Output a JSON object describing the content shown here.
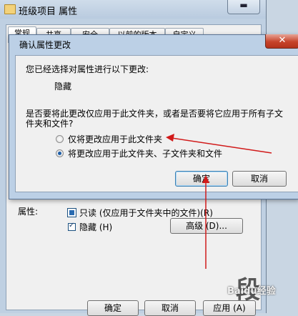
{
  "background_window": {
    "title": "班级项目 属性",
    "minimize_label": "▬",
    "tabs": [
      "常规",
      "共享",
      "安全",
      "以前的版本",
      "自定义"
    ],
    "attributes_label": "属性:",
    "readonly_label": "只读 (仅应用于文件夹中的文件)(R)",
    "hidden_label": "隐藏 (H)",
    "advanced_button": "高级 (D)...",
    "ok_button": "确定",
    "cancel_button": "取消",
    "apply_button": "应用 (A)"
  },
  "dialog": {
    "title": "确认属性更改",
    "close_label": "✕",
    "intro_text": "您已经选择对属性进行以下更改:",
    "change_item": "隐藏",
    "question_line1": "是否要将此更改仅应用于此文件夹，或者是否要将它应用于所有子文",
    "question_line2": "件夹和文件?",
    "options": [
      {
        "label": "仅将更改应用于此文件夹",
        "selected": false
      },
      {
        "label": "将更改应用于此文件夹、子文件夹和文件",
        "selected": true
      }
    ],
    "ok_button": "确定",
    "cancel_button": "取消"
  },
  "watermark": {
    "text": "Baidu经验",
    "big": "段"
  },
  "colors": {
    "arrow": "#d11a1a",
    "close_button": "#c7432a",
    "selection": "#1d5ea8"
  }
}
